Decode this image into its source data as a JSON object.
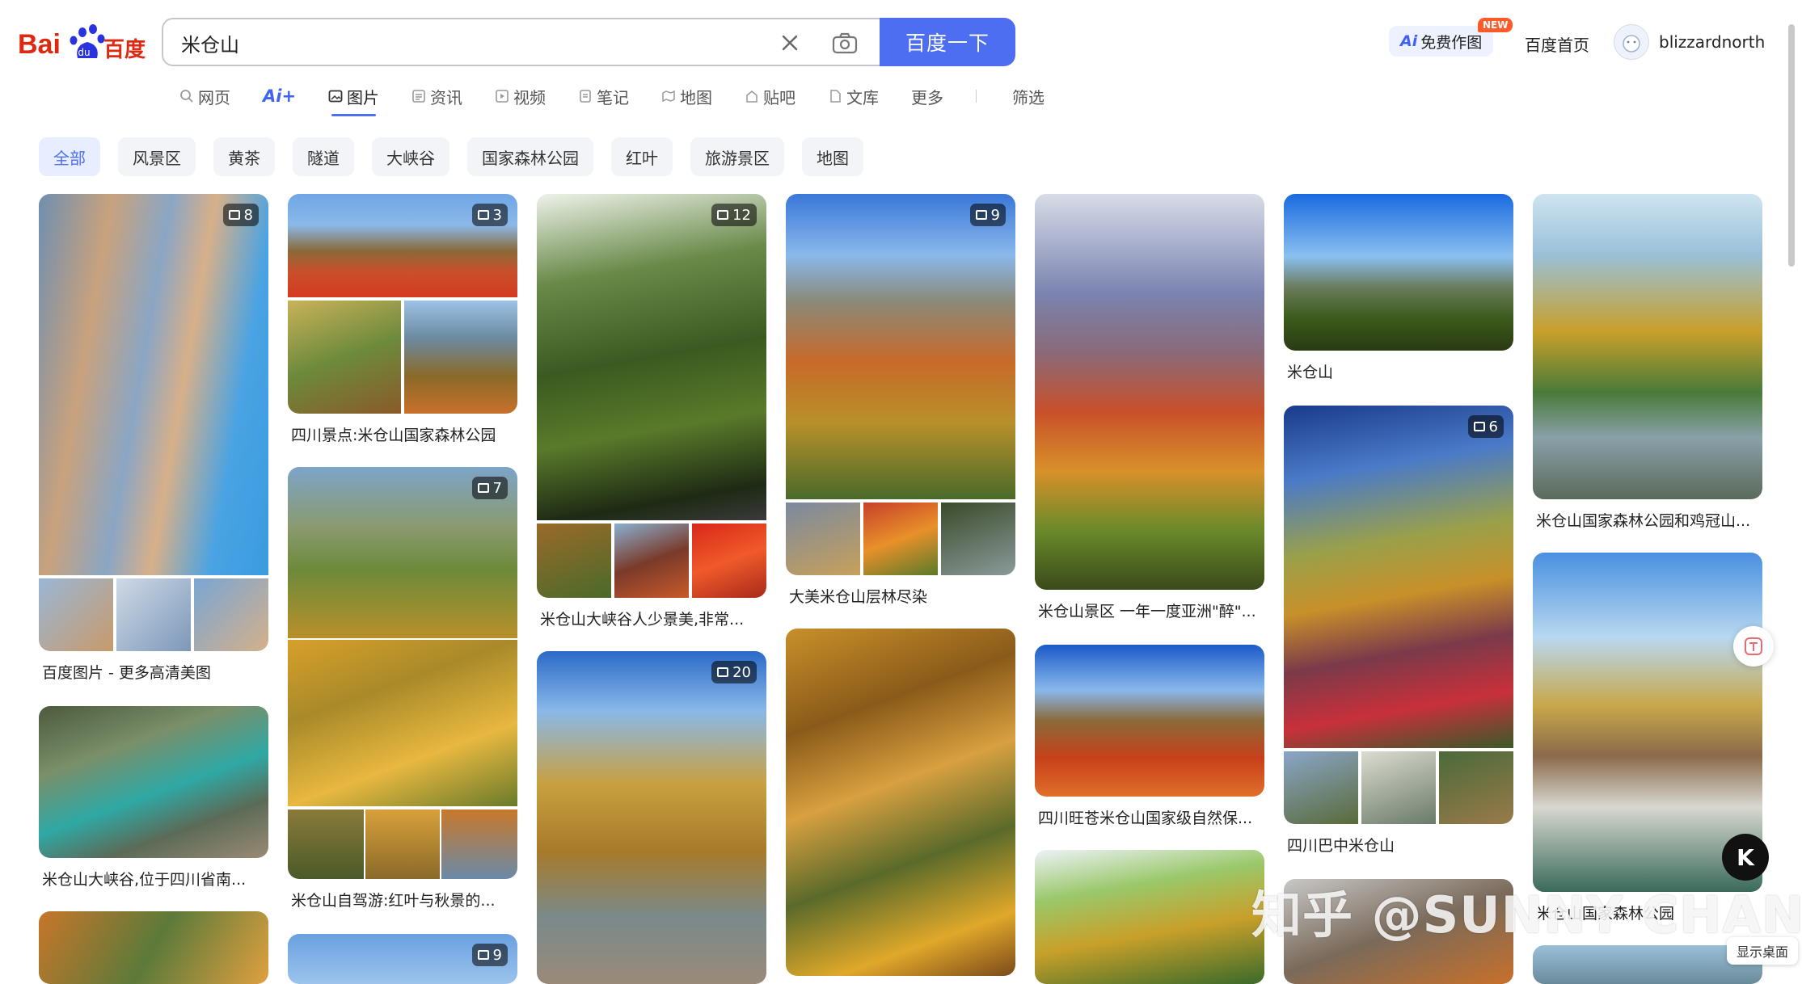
{
  "header": {
    "search_value": "米仓山",
    "search_button": "百度一下",
    "ai_image_label": "免费作图",
    "ai_prefix": "Ai",
    "new_badge": "NEW",
    "home_link": "百度首页",
    "username": "blizzardnorth"
  },
  "nav": {
    "web": "网页",
    "ai_plus": "Ai+",
    "images": "图片",
    "news": "资讯",
    "video": "视频",
    "notes": "笔记",
    "map": "地图",
    "tieba": "贴吧",
    "wenku": "文库",
    "more": "更多",
    "filter": "筛选"
  },
  "chips": [
    "全部",
    "风景区",
    "黄茶",
    "隧道",
    "大峡谷",
    "国家森林公园",
    "红叶",
    "旅游景区",
    "地图"
  ],
  "results": {
    "c1a": {
      "caption": "百度图片 - 更多高清美图",
      "count": "8"
    },
    "c1b": {
      "caption": "米仓山大峡谷,位于四川省南..."
    },
    "c2a": {
      "caption": "四川景点:米仓山国家森林公园",
      "count": "3"
    },
    "c2b": {
      "caption": "米仓山自驾游:红叶与秋景的...",
      "count": "7"
    },
    "c2c": {
      "count": "9"
    },
    "c3a": {
      "caption": "米仓山大峡谷人少景美,非常...",
      "count": "12"
    },
    "c3b": {
      "count": "20"
    },
    "c4a": {
      "caption": "大美米仓山层林尽染",
      "count": "9"
    },
    "c5a": {
      "caption": "米仓山景区 一年一度亚洲\"醉\"..."
    },
    "c5b": {
      "caption": "四川旺苍米仓山国家级自然保..."
    },
    "c6a": {
      "caption": "米仓山"
    },
    "c6b": {
      "caption": "四川巴中米仓山",
      "count": "6"
    },
    "c7a": {
      "caption": "米仓山国家森林公园和鸡冠山..."
    },
    "c7b": {
      "caption": "米仓山国家森林公园"
    }
  },
  "overlay": {
    "watermark": "知乎 @SUNNY CHAN",
    "show_desktop": "显示桌面"
  },
  "colors": {
    "accent": "#4e6ef2",
    "badge": "#ff5b2a"
  }
}
